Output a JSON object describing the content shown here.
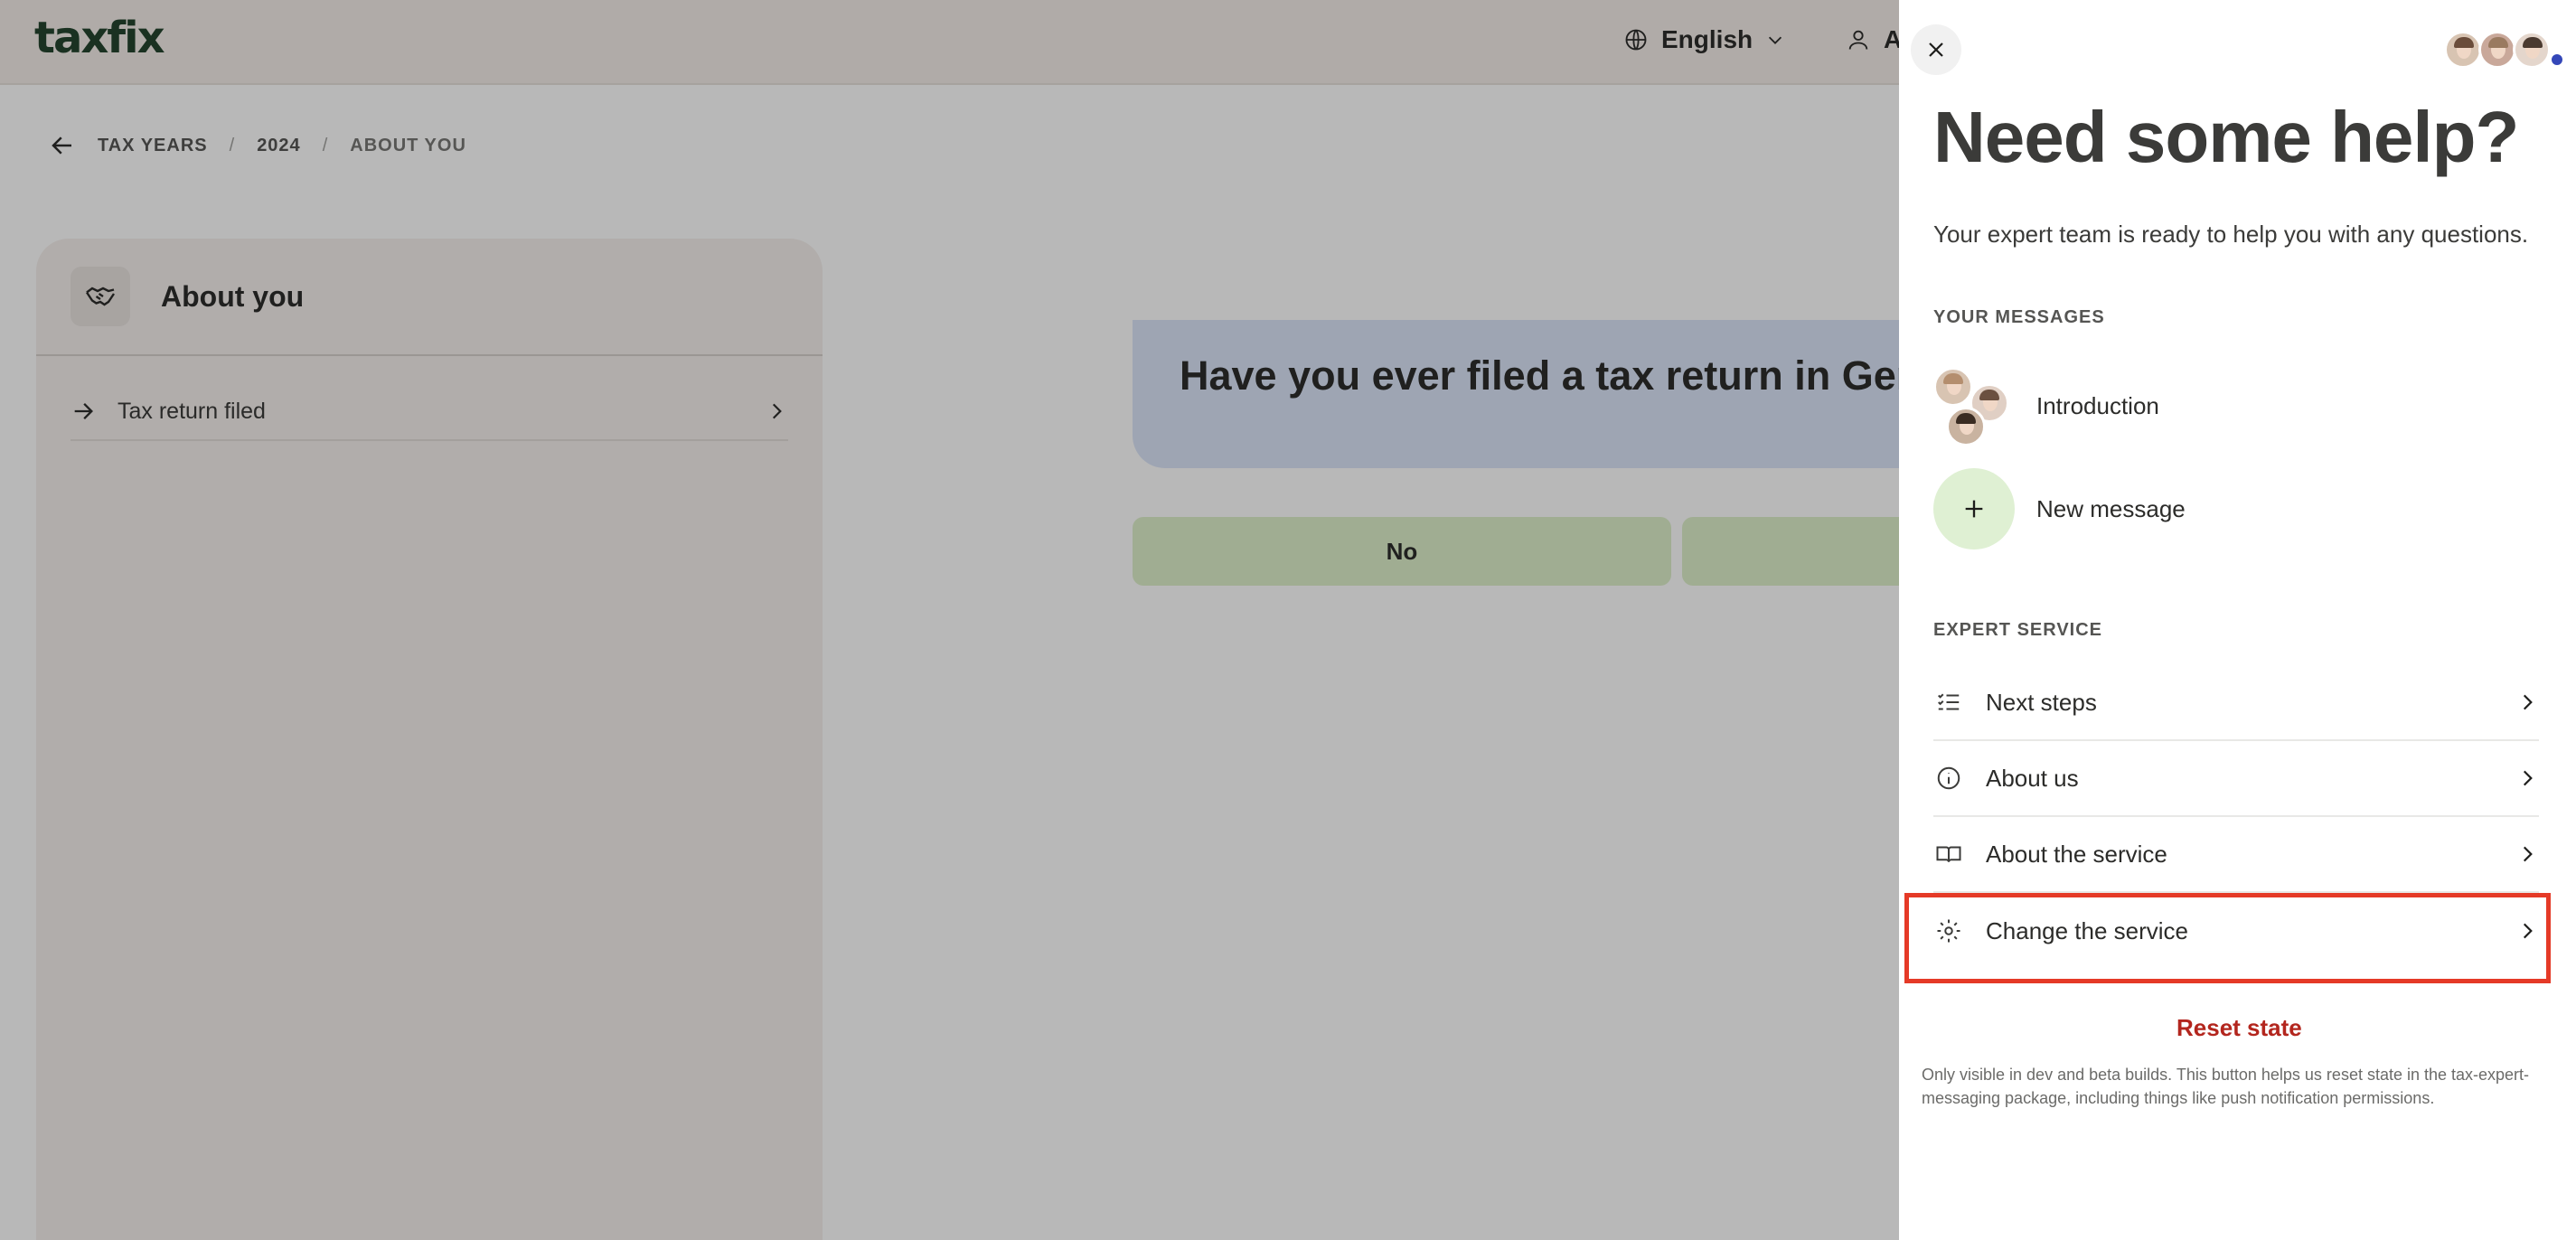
{
  "app": {
    "logo": "taxfix",
    "language_label": "English",
    "account_label": "A"
  },
  "breadcrumb": {
    "items": [
      "TAX YEARS",
      "2024",
      "ABOUT YOU"
    ],
    "separator": "/"
  },
  "sidebar": {
    "title": "About you",
    "items": [
      {
        "label": "Tax return filed"
      }
    ]
  },
  "question": {
    "text": "Have you ever filed a tax return in Germ",
    "answers": [
      "No",
      ""
    ]
  },
  "help_panel": {
    "title": "Need some help?",
    "subtitle": "Your expert team is ready to help you with any questions.",
    "messages_label": "YOUR MESSAGES",
    "messages": [
      {
        "label": "Introduction"
      },
      {
        "label": "New message"
      }
    ],
    "expert_label": "EXPERT SERVICE",
    "services": [
      {
        "label": "Next steps",
        "icon": "checklist-icon"
      },
      {
        "label": "About us",
        "icon": "info-icon"
      },
      {
        "label": "About the service",
        "icon": "book-icon"
      },
      {
        "label": "Change the service",
        "icon": "gear-icon"
      }
    ],
    "reset_label": "Reset state",
    "reset_note": "Only visible in dev and beta builds. This button helps us reset state in the tax-expert-messaging package, including things like push notification permissions."
  },
  "colors": {
    "brand": "#14371f",
    "highlight": "#e53a27",
    "reset": "#b3261e",
    "answer_bg": "#dbefc6",
    "question_bg": "#d9e3f8"
  }
}
